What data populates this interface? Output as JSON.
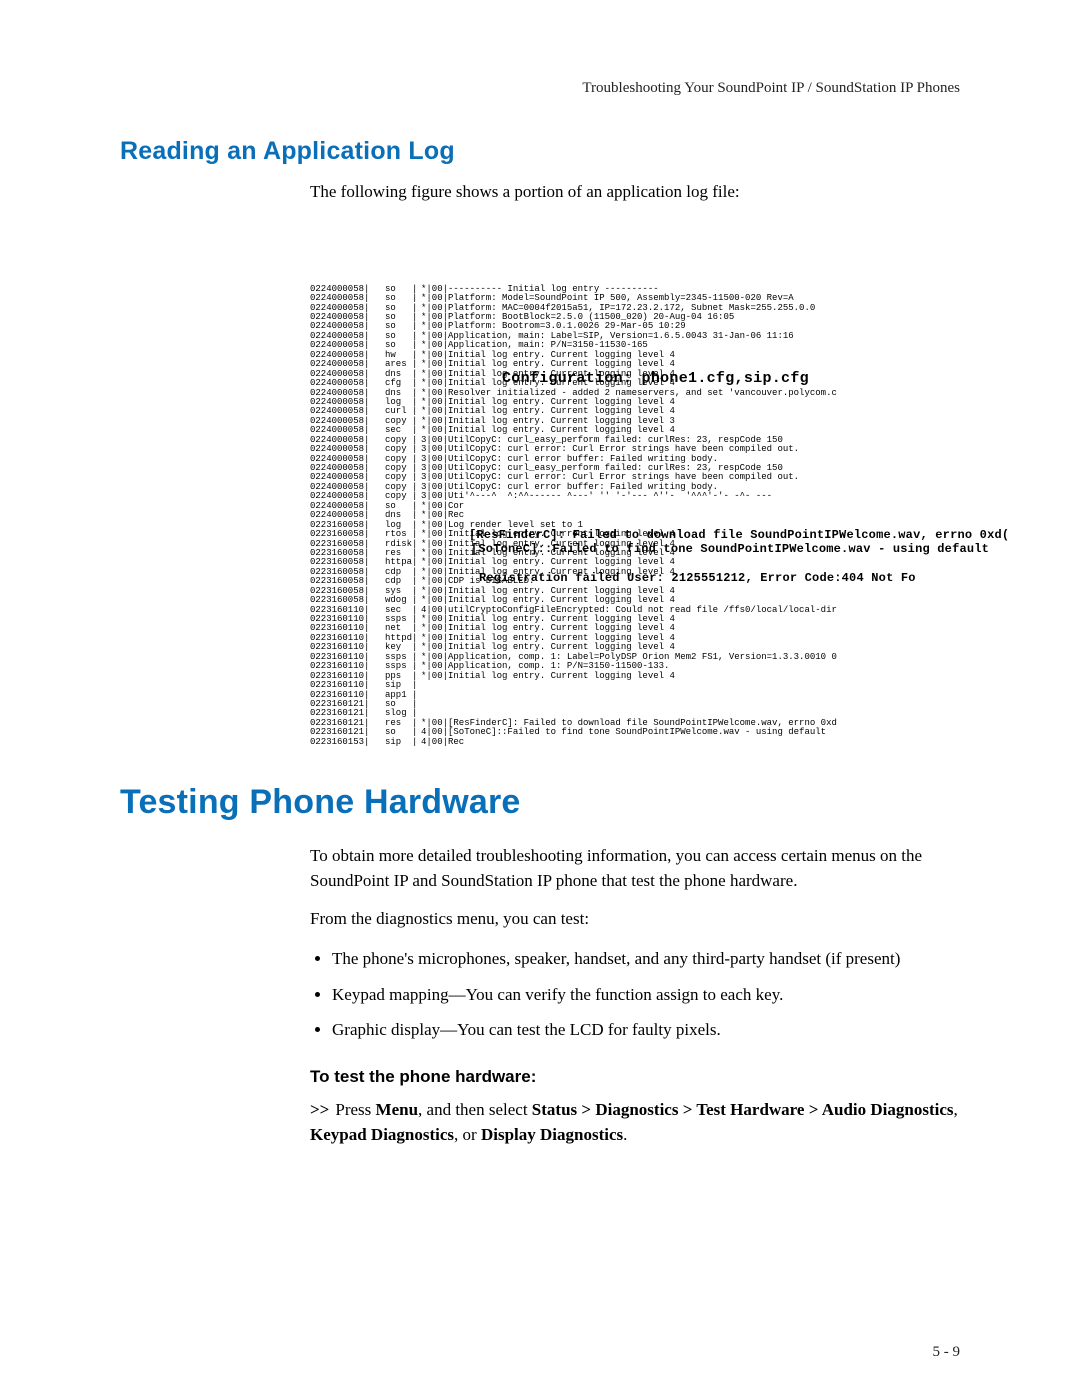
{
  "header": "Troubleshooting Your SoundPoint IP / SoundStation IP Phones",
  "footer": "5 - 9",
  "section1": {
    "title": "Reading an Application Log",
    "intro": "The following figure shows a portion of an application log file:"
  },
  "figure": {
    "annot1": "Configuration: phone1.cfg,sip.cfg",
    "annot2": "[ResFinderC]: Failed to download file SoundPointIPWelcome.wav, errno 0xd(",
    "annot3": "[SoToneC]::Failed to find tone SoundPointIPWelcome.wav - using default",
    "annot4": "Registration failed User: 2125551212, Error Code:404 Not Fo",
    "lines": [
      {
        "ts": "0224000058",
        "mod": "so",
        "lvl": "*|00|",
        "msg": "---------- Initial log entry ----------"
      },
      {
        "ts": "0224000058",
        "mod": "so",
        "lvl": "*|00|",
        "msg": "Platform: Model=SoundPoint IP 500, Assembly=2345-11500-020 Rev=A"
      },
      {
        "ts": "0224000058",
        "mod": "so",
        "lvl": "*|00|",
        "msg": "Platform: MAC=0004f2015a51, IP=172.23.2.172, Subnet Mask=255.255.0.0"
      },
      {
        "ts": "0224000058",
        "mod": "so",
        "lvl": "*|00|",
        "msg": "Platform: BootBlock=2.5.0 (11500_020) 20-Aug-04 16:05"
      },
      {
        "ts": "0224000058",
        "mod": "so",
        "lvl": "*|00|",
        "msg": "Platform: Bootrom=3.0.1.0026 29-Mar-05 10:29"
      },
      {
        "ts": "0224000058",
        "mod": "so",
        "lvl": "*|00|",
        "msg": "Application, main: Label=SIP, Version=1.6.5.0043 31-Jan-06 11:16"
      },
      {
        "ts": "0224000058",
        "mod": "so",
        "lvl": "*|00|",
        "msg": "Application, main: P/N=3150-11530-165"
      },
      {
        "ts": "0224000058",
        "mod": "hw",
        "lvl": "*|00|",
        "msg": "Initial log entry. Current logging level 4"
      },
      {
        "ts": "0224000058",
        "mod": "ares",
        "lvl": "*|00|",
        "msg": "Initial log entry. Current logging level 4"
      },
      {
        "ts": "0224000058",
        "mod": "dns",
        "lvl": "*|00|",
        "msg": "Initial log entry. Current logging level 4"
      },
      {
        "ts": "0224000058",
        "mod": "cfg",
        "lvl": "*|00|",
        "msg": "Initial log entry. Current logging level 4"
      },
      {
        "ts": "0224000058",
        "mod": "dns",
        "lvl": "*|00|",
        "msg": "Resolver initialized - added 2 nameservers, and set 'vancouver.polycom.c"
      },
      {
        "ts": "0224000058",
        "mod": "log",
        "lvl": "*|00|",
        "msg": "Initial log entry. Current logging level 4"
      },
      {
        "ts": "0224000058",
        "mod": "curl",
        "lvl": "*|00|",
        "msg": "Initial log entry. Current logging level 4"
      },
      {
        "ts": "0224000058",
        "mod": "copy",
        "lvl": "*|00|",
        "msg": "Initial log entry. Current logging level 3"
      },
      {
        "ts": "0224000058",
        "mod": "sec",
        "lvl": "*|00|",
        "msg": "Initial log entry. Current logging level 4"
      },
      {
        "ts": "0224000058",
        "mod": "copy",
        "lvl": "3|00|",
        "msg": "UtilCopyC: curl_easy_perform failed: curlRes: 23, respCode 150"
      },
      {
        "ts": "0224000058",
        "mod": "copy",
        "lvl": "3|00|",
        "msg": "UtilCopyC: curl error: Curl Error strings have been compiled out."
      },
      {
        "ts": "0224000058",
        "mod": "copy",
        "lvl": "3|00|",
        "msg": "UtilCopyC: curl error buffer: Failed writing body."
      },
      {
        "ts": "0224000058",
        "mod": "copy",
        "lvl": "3|00|",
        "msg": "UtilCopyC: curl_easy_perform failed: curlRes: 23, respCode 150"
      },
      {
        "ts": "0224000058",
        "mod": "copy",
        "lvl": "3|00|",
        "msg": "UtilCopyC: curl error: Curl Error strings have been compiled out."
      },
      {
        "ts": "0224000058",
        "mod": "copy",
        "lvl": "3|00|",
        "msg": "UtilCopyC: curl error buffer: Failed writing body."
      },
      {
        "ts": "0224000058",
        "mod": "copy",
        "lvl": "3|00|",
        "msg": "Uti'^---^  ^:^^------ ^---' '' '-'--- ^''-  '^^^'-'- -^- ---"
      },
      {
        "ts": "0224000058",
        "mod": "so",
        "lvl": "*|00|",
        "msg": "Cor"
      },
      {
        "ts": "0224000058",
        "mod": "dns",
        "lvl": "*|00|",
        "msg": "Rec"
      },
      {
        "ts": "0223160058",
        "mod": "log",
        "lvl": "*|00|",
        "msg": "Log render level set to 1"
      },
      {
        "ts": "0223160058",
        "mod": "rtos",
        "lvl": "*|00|",
        "msg": "Initial log entry. Current logging level 4"
      },
      {
        "ts": "0223160058",
        "mod": "rdisk",
        "lvl": "*|00|",
        "msg": "Initial log entry. Current logging level 4"
      },
      {
        "ts": "0223160058",
        "mod": "res",
        "lvl": "*|00|",
        "msg": "Initial log entry. Current logging level 4"
      },
      {
        "ts": "0223160058",
        "mod": "httpa",
        "lvl": "*|00|",
        "msg": "Initial log entry. Current logging level 4"
      },
      {
        "ts": "0223160058",
        "mod": "cdp",
        "lvl": "*|00|",
        "msg": "Initial log entry. Current logging level 4"
      },
      {
        "ts": "0223160058",
        "mod": "cdp",
        "lvl": "*|00|",
        "msg": "CDP is DISABLED."
      },
      {
        "ts": "0223160058",
        "mod": "sys",
        "lvl": "*|00|",
        "msg": "Initial log entry. Current logging level 4"
      },
      {
        "ts": "0223160058",
        "mod": "wdog",
        "lvl": "*|00|",
        "msg": "Initial log entry. Current logging level 4"
      },
      {
        "ts": "0223160110",
        "mod": "sec",
        "lvl": "4|00|",
        "msg": "utilCryptoConfigFileEncrypted: Could not read file /ffs0/local/local-dir"
      },
      {
        "ts": "0223160110",
        "mod": "ssps",
        "lvl": "*|00|",
        "msg": "Initial log entry. Current logging level 4"
      },
      {
        "ts": "0223160110",
        "mod": "net",
        "lvl": "*|00|",
        "msg": "Initial log entry. Current logging level 4"
      },
      {
        "ts": "0223160110",
        "mod": "httpd",
        "lvl": "*|00|",
        "msg": "Initial log entry. Current logging level 4"
      },
      {
        "ts": "0223160110",
        "mod": "key",
        "lvl": "*|00|",
        "msg": "Initial log entry. Current logging level 4"
      },
      {
        "ts": "0223160110",
        "mod": "ssps",
        "lvl": "*|00|",
        "msg": "Application, comp. 1: Label=PolyDSP Orion Mem2 FS1, Version=1.3.3.0010 0"
      },
      {
        "ts": "0223160110",
        "mod": "ssps",
        "lvl": "*|00|",
        "msg": "Application, comp. 1: P/N=3150-11500-133."
      },
      {
        "ts": "0223160110",
        "mod": "pps",
        "lvl": "*|00|",
        "msg": "Initial log entry. Current logging level 4"
      },
      {
        "ts": "0223160110",
        "mod": "sip",
        "lvl": "",
        "msg": ""
      },
      {
        "ts": "0223160110",
        "mod": "app1",
        "lvl": "",
        "msg": ""
      },
      {
        "ts": "0223160121",
        "mod": "so",
        "lvl": "",
        "msg": ""
      },
      {
        "ts": "0223160121",
        "mod": "slog",
        "lvl": "",
        "msg": ""
      },
      {
        "ts": "0223160121",
        "mod": "res",
        "lvl": "*|00|",
        "msg": "[ResFinderC]: Failed to download file SoundPointIPWelcome.wav, errno 0xd"
      },
      {
        "ts": "0223160121",
        "mod": "so",
        "lvl": "4|00|",
        "msg": "[SoToneC]::Failed to find tone SoundPointIPWelcome.wav - using default"
      },
      {
        "ts": "0223160153",
        "mod": "sip",
        "lvl": "4|00|",
        "msg": "Rec"
      }
    ]
  },
  "section2": {
    "title": "Testing Phone Hardware",
    "p1": "To obtain more detailed troubleshooting information, you can access certain menus on the SoundPoint IP and SoundStation IP phone that test the phone hardware.",
    "p2": "From the diagnostics menu, you can test:",
    "bullets": [
      "The phone's microphones, speaker, handset, and any third-party handset (if present)",
      "Keypad mapping—You can verify the function assign to each key.",
      "Graphic display—You can test the LCD for faulty pixels."
    ],
    "subhead": "To test the phone hardware:",
    "step_arrow": ">>",
    "step_text_1": "Press ",
    "step_menu": "Menu",
    "step_text_2": ", and then select ",
    "step_path": "Status > Diagnostics > Test Hardware > Audio Diagnostics",
    "step_text_3": ", ",
    "step_keypad": "Keypad Diagnostics",
    "step_text_4": ", or ",
    "step_display": "Display Diagnostics",
    "step_text_5": "."
  }
}
